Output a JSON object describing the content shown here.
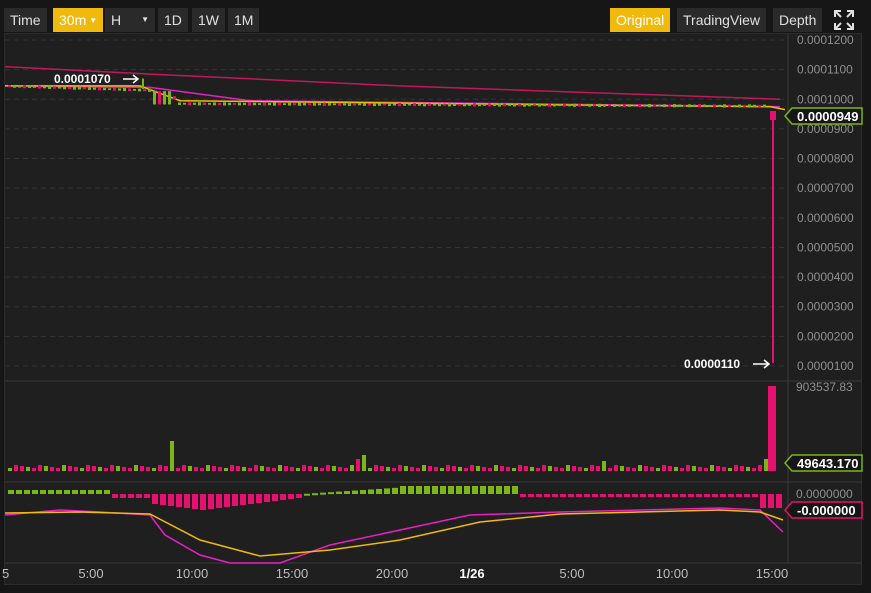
{
  "toolbar": {
    "time_label": "Time",
    "interval_selected": "30m",
    "hour_label": "H",
    "d1_label": "1D",
    "w1_label": "1W",
    "m1_label": "1M",
    "original_label": "Original",
    "tradingview_label": "TradingView",
    "depth_label": "Depth",
    "fullscreen_icon": "fullscreen-icon",
    "active_color": "#f0b90b"
  },
  "colors": {
    "up": "#7cb518",
    "down": "#e6106e",
    "ma_yellow": "#f0b90b",
    "ma_magenta": "#e91ec4",
    "ma_crimson": "#c2185b",
    "grid": "#333333",
    "axis_text": "#8f8f8f"
  },
  "chart_data": [
    {
      "type": "candlestick",
      "pair_price_axis": {
        "ticks": [
          "0.0001200",
          "0.0001100",
          "0.0001000",
          "0.0000900",
          "0.0000800",
          "0.0000700",
          "0.0000600",
          "0.0000500",
          "0.0000400",
          "0.0000300",
          "0.0000200",
          "0.0000100"
        ],
        "tick_values": [
          0.00012,
          0.00011,
          0.0001,
          9e-05,
          8e-05,
          7e-05,
          6e-05,
          5e-05,
          4e-05,
          3e-05,
          2e-05,
          1e-05
        ],
        "ylim": [
          8.5e-06,
          0.000122
        ]
      },
      "last_price_label": "0.0000949",
      "last_price": 9.49e-05,
      "high_annotation": "0.0001070",
      "high_value": 0.000107,
      "low_annotation": "0.0000110",
      "low_value": 1.1e-05,
      "ma_long": [
        0.000111,
        0.0001045,
        0.0001
      ],
      "ma_mid": [
        0.0001045,
        9.9e-05,
        9.85e-05
      ],
      "candles_note": "approx 30m candles drifting from ~0.0001045 to ~0.0000980 with final drop to 0.0000949"
    },
    {
      "type": "bar",
      "name_label": "volume",
      "top_label": "903537.83",
      "top_value": 903537.83,
      "current_label": "49643.170",
      "current_value": 49643.17
    },
    {
      "type": "bar",
      "macd_zero_label": "0.0000000",
      "macd_current_label": "-0.000000"
    }
  ],
  "x_axis": {
    "ticks": [
      "5:00",
      "10:00",
      "15:00",
      "20:00",
      "1/26",
      "5:00",
      "10:00",
      "15:00"
    ],
    "left_partial": "5"
  }
}
